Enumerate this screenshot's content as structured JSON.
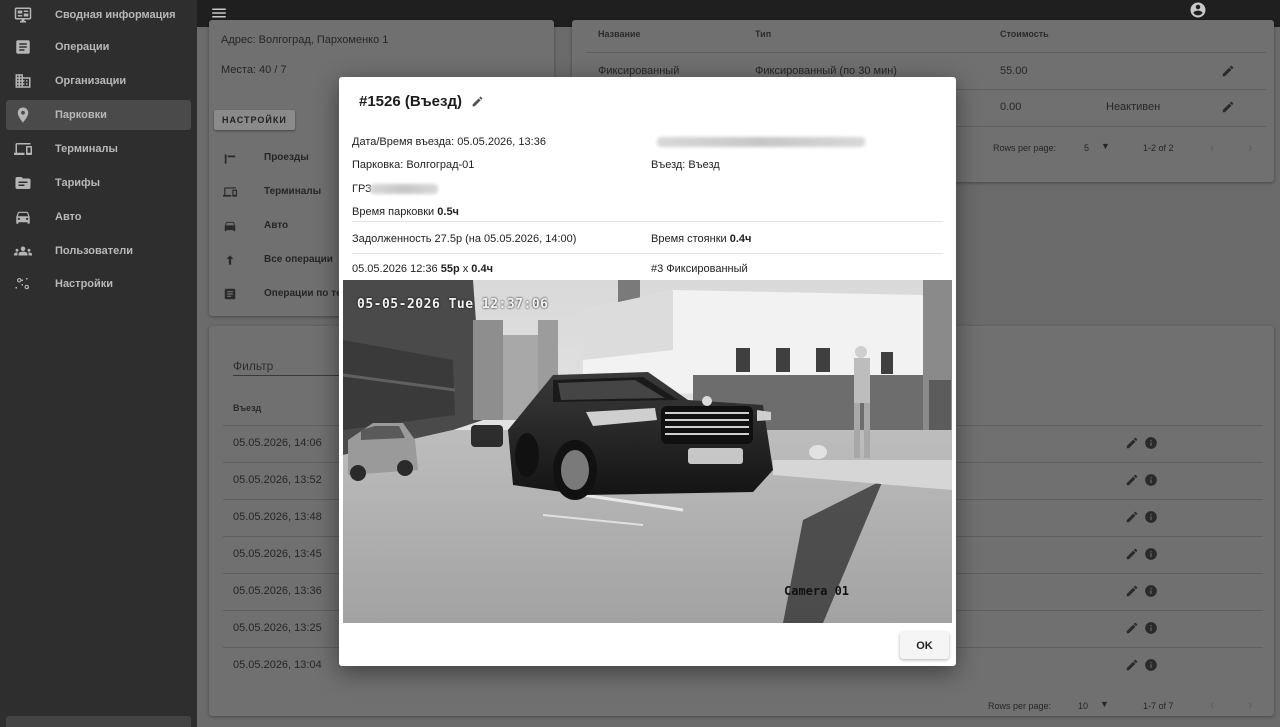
{
  "sidebar": {
    "items": [
      {
        "label": "Сводная информация",
        "icon": "dashboard-icon"
      },
      {
        "label": "Операции",
        "icon": "list-icon"
      },
      {
        "label": "Организации",
        "icon": "building-icon"
      },
      {
        "label": "Парковки",
        "icon": "location-pin-icon",
        "active": true
      },
      {
        "label": "Терминалы",
        "icon": "devices-icon"
      },
      {
        "label": "Тарифы",
        "icon": "folder-icon"
      },
      {
        "label": "Авто",
        "icon": "car-icon"
      },
      {
        "label": "Пользователи",
        "icon": "people-icon"
      },
      {
        "label": "Настройки",
        "icon": "settings-icon"
      }
    ]
  },
  "background": {
    "address": "Адрес: Волгоград, Пархоменко 1",
    "places": "Места: 40 / 7",
    "settings_button": "НАСТРОЙКИ",
    "settings_links": [
      "Проезды",
      "Терминалы",
      "Авто",
      "Все операции",
      "Операции по те"
    ],
    "tariffs_table": {
      "headers": [
        "Название",
        "Тип",
        "Стоимость"
      ],
      "rows": [
        {
          "name": "Фиксированный",
          "type": "Фиксированный (по 30 мин)",
          "cost": "55.00",
          "status": ""
        },
        {
          "name": "",
          "type": "",
          "cost": "0.00",
          "status": "Неактивен"
        }
      ],
      "rows_per_page_label": "Rows per page:",
      "rows_per_page": "5",
      "range": "1-2 of 2"
    },
    "filter_label": "Фильтр",
    "ops_table": {
      "header": "Въезд",
      "rows": [
        "05.05.2026, 14:06",
        "05.05.2026, 13:52",
        "05.05.2026, 13:48",
        "05.05.2026, 13:45",
        "05.05.2026, 13:36",
        "05.05.2026, 13:25",
        "05.05.2026, 13:04"
      ],
      "rows_per_page_label": "Rows per page:",
      "rows_per_page": "10",
      "range": "1-7 of 7"
    }
  },
  "modal": {
    "title": "#1526 (Въезд)",
    "entry_datetime": "Дата/Время въезда: 05.05.2026, 13:36",
    "parking": "Парковка: Волгоград-01",
    "entry_label": "Въезд: Въезд",
    "plate_label": "ГРЗ",
    "parking_time_label": "Время парковки",
    "parking_time_value": "0.5ч",
    "debt": "Задолженность 27.5р (на 05.05.2026, 14:00)",
    "stay_time_label": "Время стоянки",
    "stay_time_value": "0.4ч",
    "charge_prefix": "05.05.2026 12:36",
    "charge_amount": "55р",
    "charge_mult": "х",
    "charge_duration": "0.4ч",
    "tariff": "#3 Фиксированный",
    "camera_timestamp": "05-05-2026 Tue 12:37:06",
    "camera_label": "Camera 01",
    "ok_button": "OK"
  }
}
